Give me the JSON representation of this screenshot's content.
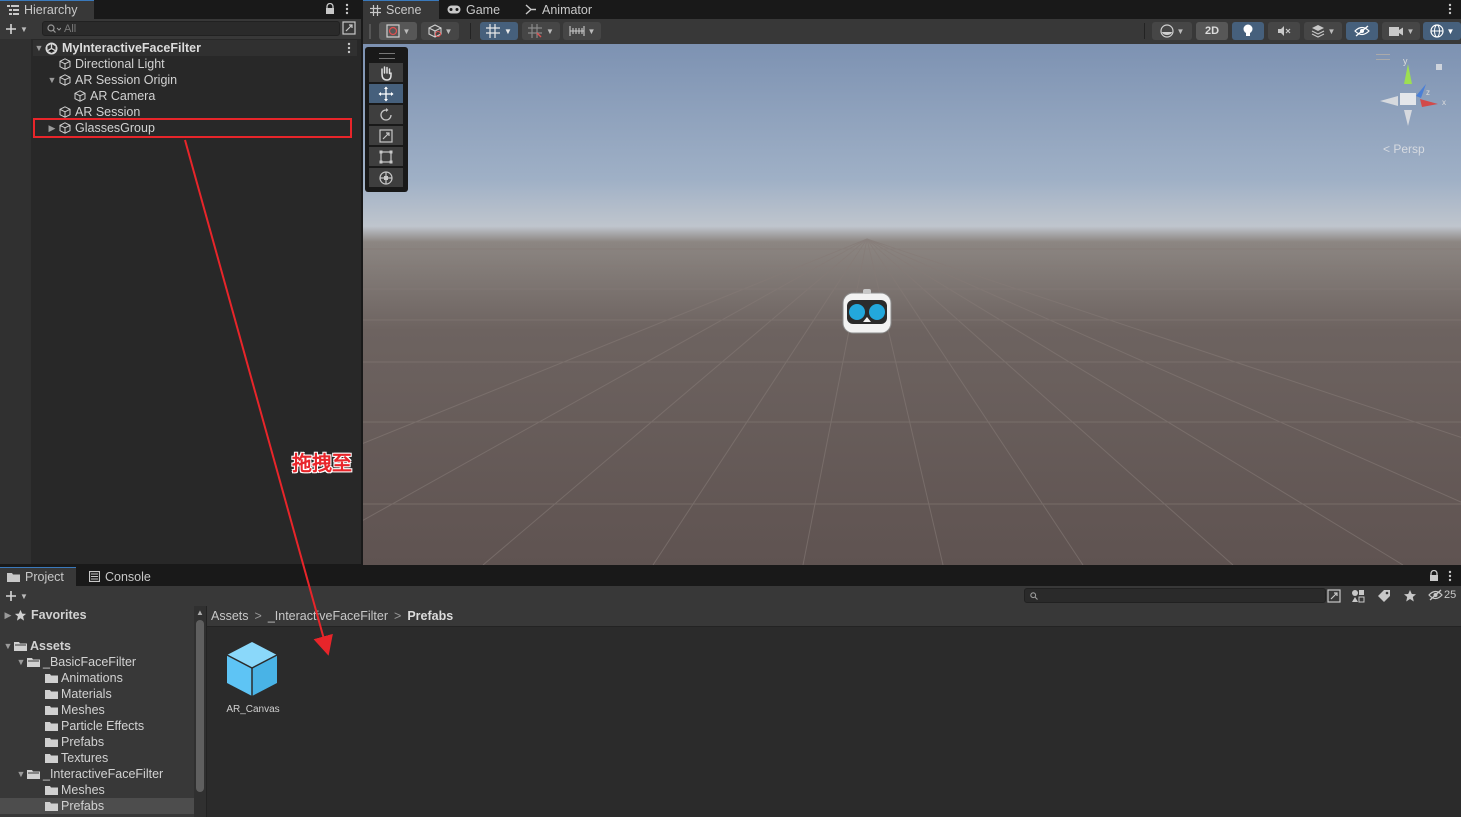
{
  "hierarchy": {
    "tab_label": "Hierarchy",
    "search_placeholder": "All",
    "items": [
      {
        "label": "MyInteractiveFaceFilter"
      },
      {
        "label": "Directional Light"
      },
      {
        "label": "AR Session Origin"
      },
      {
        "label": "AR Camera"
      },
      {
        "label": "AR Session"
      },
      {
        "label": "GlassesGroup"
      }
    ]
  },
  "scene_tabs": [
    {
      "label": "Scene"
    },
    {
      "label": "Game"
    },
    {
      "label": "Animator"
    }
  ],
  "scene_toolbar": {
    "mode_2d_label": "2D"
  },
  "gizmo": {
    "axis_y": "y",
    "axis_x": "x",
    "axis_z": "z",
    "persp_label": "< Persp"
  },
  "annotation": {
    "label": "拖拽至",
    "color": "#e8252a"
  },
  "bottom_tabs": [
    {
      "label": "Project"
    },
    {
      "label": "Console"
    }
  ],
  "project": {
    "hidden_count": "25",
    "favorites_label": "Favorites",
    "tree": [
      {
        "label": "Assets"
      },
      {
        "label": "_BasicFaceFilter"
      },
      {
        "label": "Animations"
      },
      {
        "label": "Materials"
      },
      {
        "label": "Meshes"
      },
      {
        "label": "Particle Effects"
      },
      {
        "label": "Prefabs"
      },
      {
        "label": "Textures"
      },
      {
        "label": "_InteractiveFaceFilter"
      },
      {
        "label": "Meshes"
      },
      {
        "label": "Prefabs"
      }
    ],
    "breadcrumb": [
      "Assets",
      "_InteractiveFaceFilter",
      "Prefabs"
    ],
    "assets": [
      {
        "label": "AR_Canvas"
      }
    ]
  },
  "colors": {
    "accent": "#3a79bb",
    "prefab_blue": "#5ec4f5",
    "selection": "#46607c",
    "highlight_box": "#e8252a"
  }
}
